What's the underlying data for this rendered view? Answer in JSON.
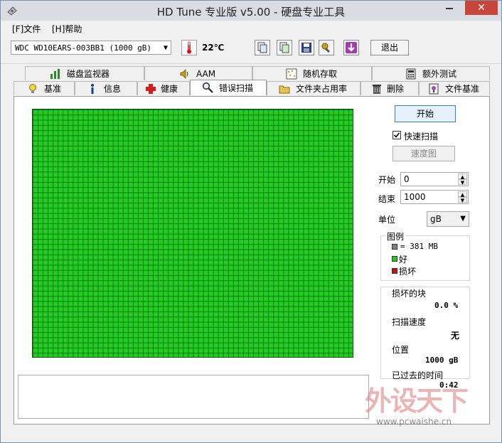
{
  "window": {
    "title": "HD Tune 专业版 v5.00 - 硬盘专业工具",
    "close_label": "✕"
  },
  "menu": {
    "file": "[F]文件",
    "help": "[H]帮助"
  },
  "toolbar": {
    "drive": "WDC WD10EARS-003BB1 (1000 gB)",
    "temperature": "22℃",
    "exit": "退出"
  },
  "tabs_top": [
    "磁盘监视器",
    "AAM",
    "随机存取",
    "额外测试"
  ],
  "tabs_bottom": [
    "基准",
    "信息",
    "健康",
    "错误扫描",
    "文件夹占用率",
    "删除",
    "文件基准"
  ],
  "scan": {
    "start_button": "开始",
    "quick_scan_label": "快速扫描",
    "quick_scan_checked": true,
    "speed_map_button": "速度图",
    "start_label": "开始",
    "start_value": "0",
    "end_label": "结束",
    "end_value": "1000",
    "unit_label": "单位",
    "unit_value": "gB"
  },
  "legend": {
    "title": "图例",
    "block_size": "= 381 MB",
    "good": "好",
    "bad": "损坏",
    "colors": {
      "block": "#808080",
      "good": "#22cc22",
      "bad": "#cc1111"
    }
  },
  "stats": {
    "damaged_label": "损坏的块",
    "damaged_value": "0.0 %",
    "speed_label": "扫描速度",
    "speed_value": "无",
    "position_label": "位置",
    "position_value": "1000 gB",
    "elapsed_label": "已过去的时间",
    "elapsed_value": "0:42"
  },
  "watermark": {
    "text": "外设天下",
    "url": "www.pcwaishe.cn"
  }
}
